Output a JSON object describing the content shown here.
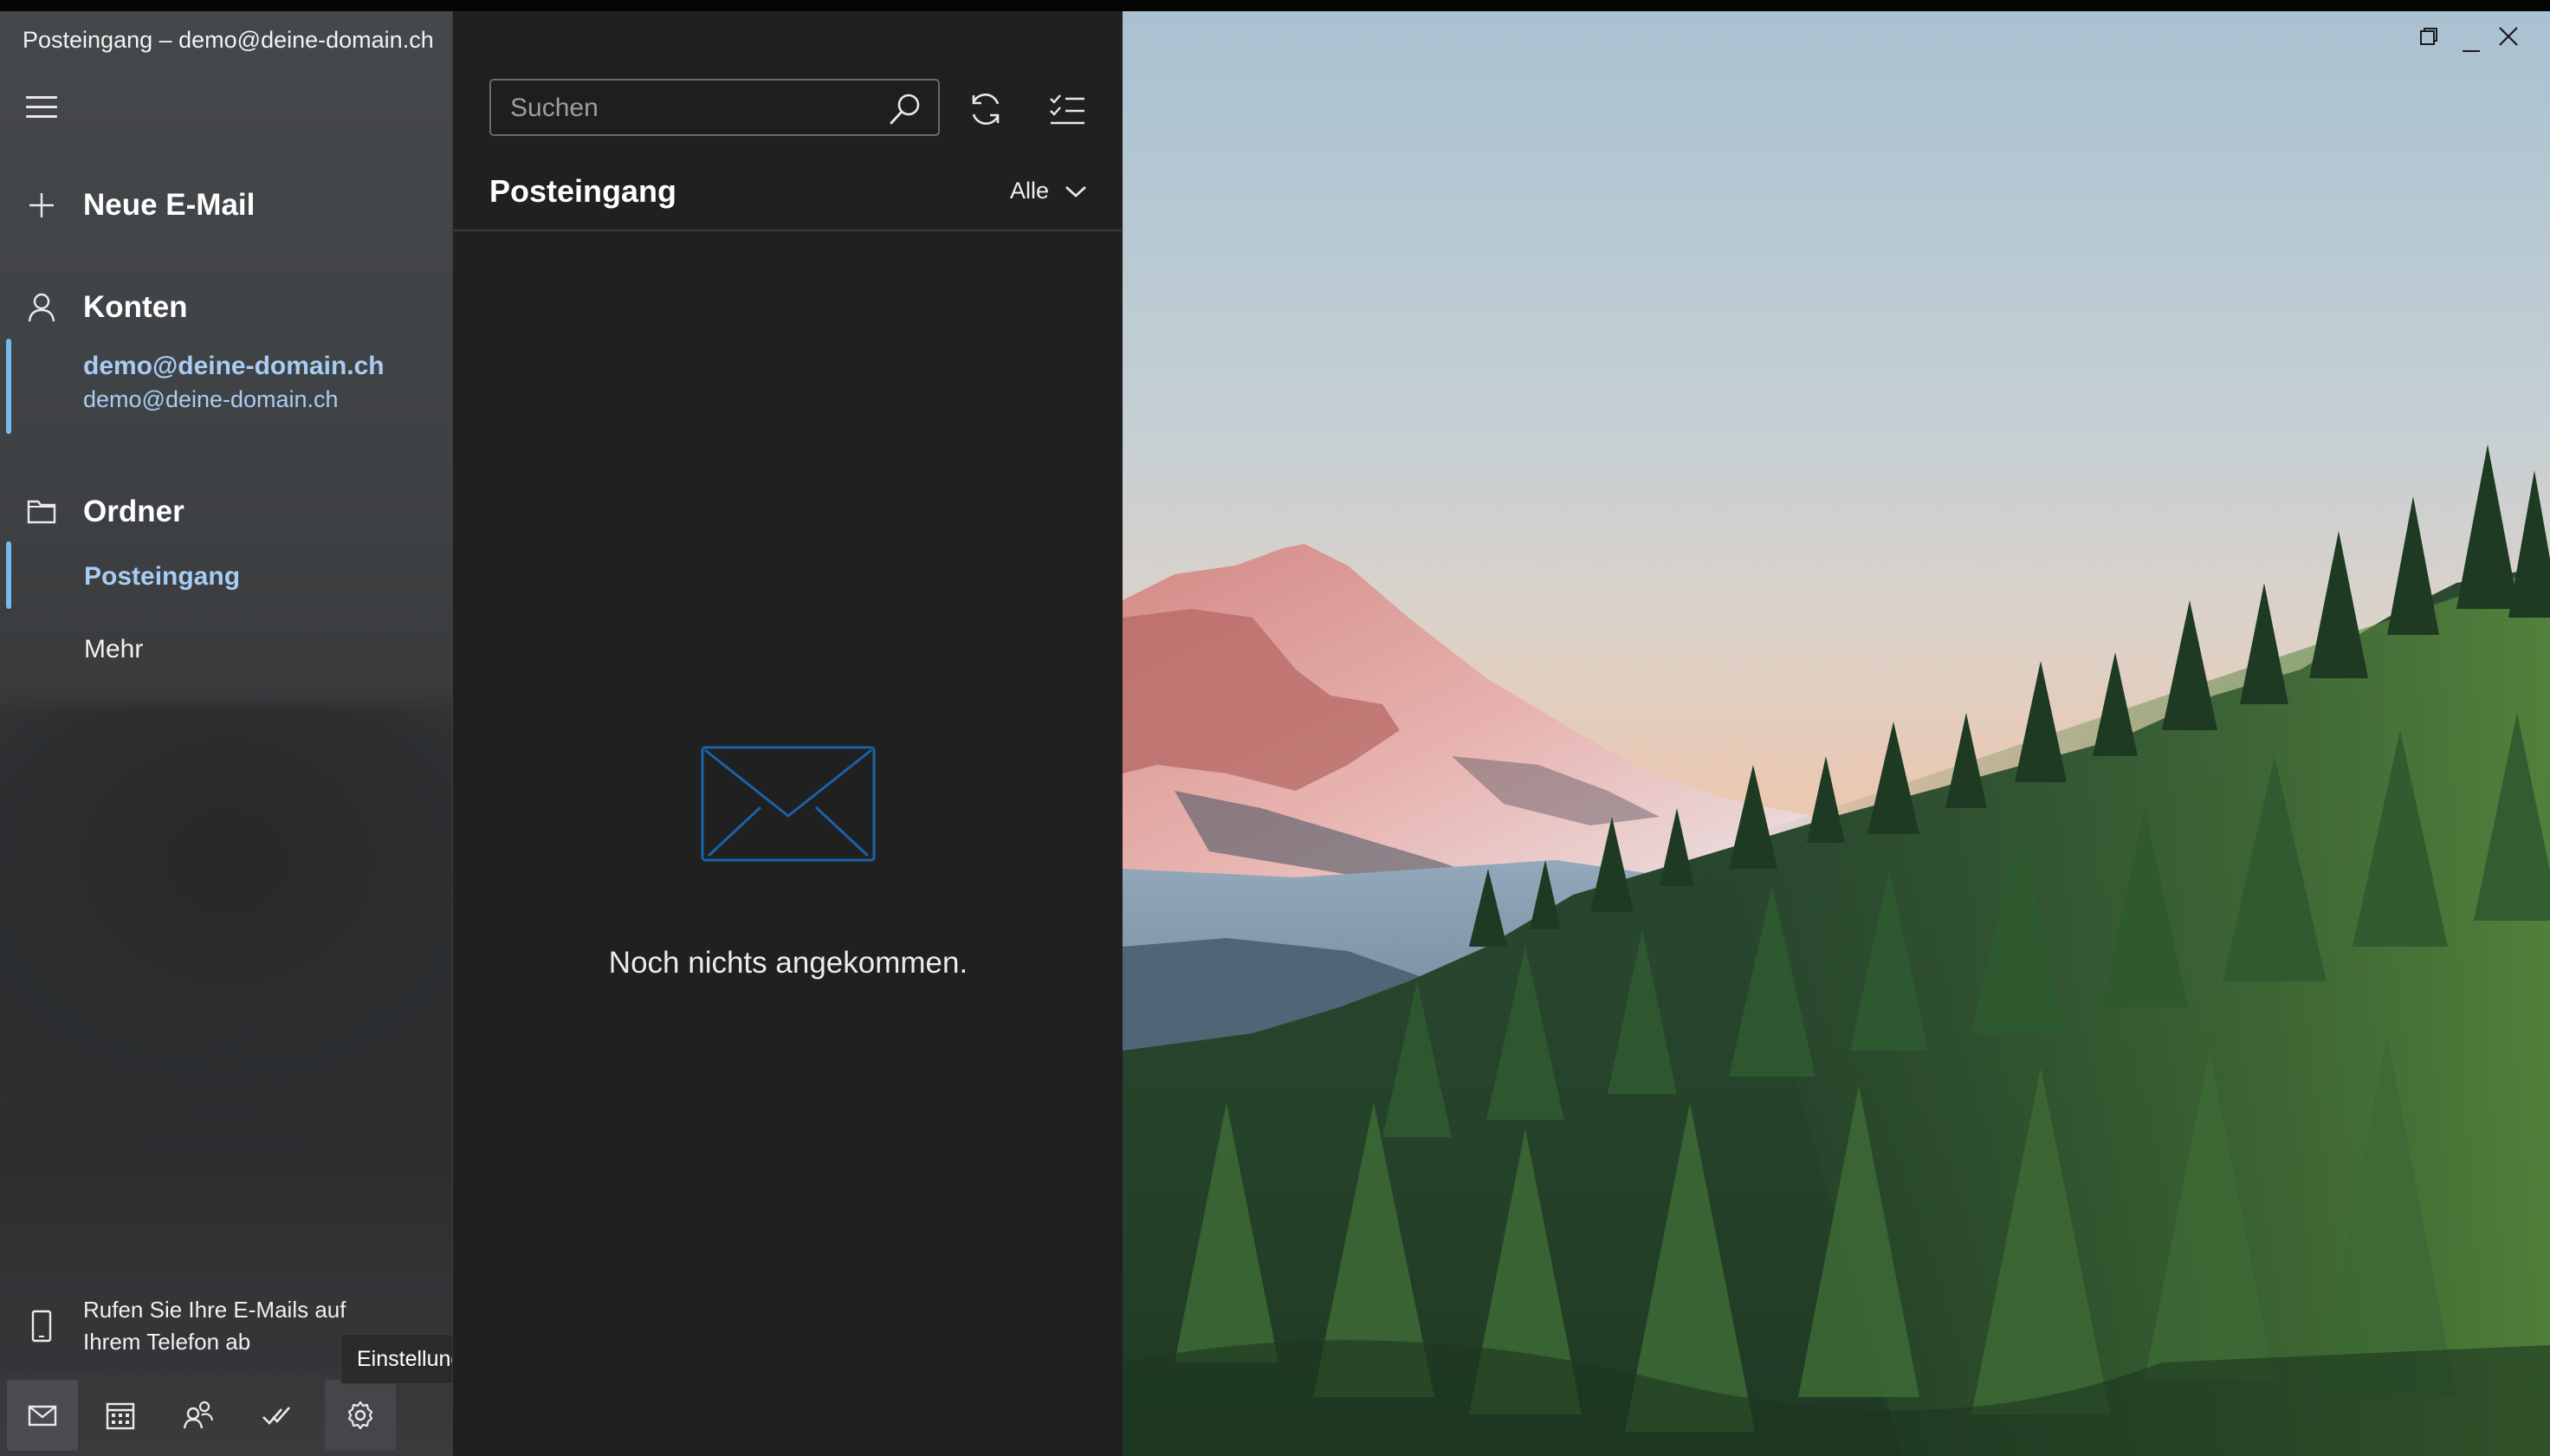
{
  "window": {
    "title": "Posteingang – demo@deine-domain.ch"
  },
  "nav": {
    "new_mail_label": "Neue E-Mail",
    "accounts_label": "Konten",
    "account": {
      "name": "demo@deine-domain.ch",
      "email": "demo@deine-domain.ch"
    },
    "folders_label": "Ordner",
    "folders": [
      {
        "label": "Posteingang",
        "selected": true
      },
      {
        "label": "Mehr",
        "selected": false
      }
    ],
    "phone_promo": "Rufen Sie Ihre E-Mails auf Ihrem Telefon ab",
    "bottom_icons": [
      "mail-icon",
      "calendar-icon",
      "people-icon",
      "todo-icon",
      "settings-icon"
    ],
    "tooltip": "Einstellungen"
  },
  "list": {
    "search_placeholder": "Suchen",
    "heading": "Posteingang",
    "filter_label": "Alle",
    "empty_message": "Noch nichts angekommen."
  },
  "colors": {
    "accent": "#76b9ed",
    "selected_text": "#a8cdf4",
    "list_bg": "#202020"
  }
}
